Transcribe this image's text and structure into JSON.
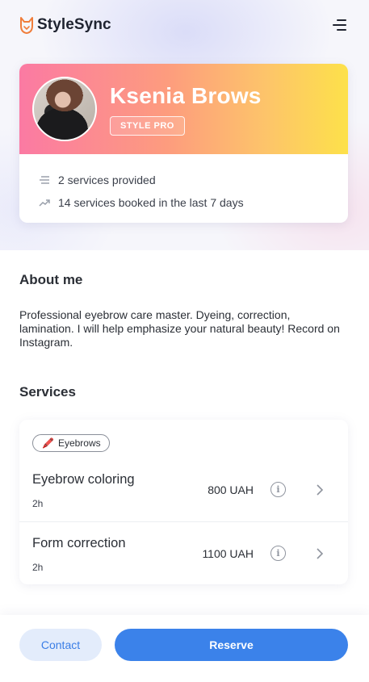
{
  "app": {
    "brand_name": "StyleSync",
    "brand_icon": "fox-logo-icon",
    "accent_color": "#f07d3a"
  },
  "header": {
    "menu_icon": "menu-lines-icon"
  },
  "profile": {
    "name": "Ksenia Brows",
    "badge": "STYLE PRO",
    "avatar_icon": "avatar",
    "banner_gradient": [
      "#fb7aa3",
      "#fd9c7e",
      "#fdc46a",
      "#fde14a"
    ],
    "stats": [
      {
        "icon": "list-icon",
        "text": "2 services provided"
      },
      {
        "icon": "trend-up-icon",
        "text": "14 services booked in the last 7 days"
      }
    ]
  },
  "about": {
    "title": "About me",
    "text": "Professional eyebrow care master. Dyeing, correction, lamination. I will help emphasize your natural beauty! Record on Instagram."
  },
  "services": {
    "title": "Services",
    "category": {
      "emoji": "🖍️",
      "label": "Eyebrows"
    },
    "items": [
      {
        "name": "Eyebrow coloring",
        "duration": "2h",
        "price": "800 UAH"
      },
      {
        "name": "Form correction",
        "duration": "2h",
        "price": "1100 UAH"
      }
    ]
  },
  "actions": {
    "contact_label": "Contact",
    "reserve_label": "Reserve",
    "primary_color": "#3b82ea"
  }
}
